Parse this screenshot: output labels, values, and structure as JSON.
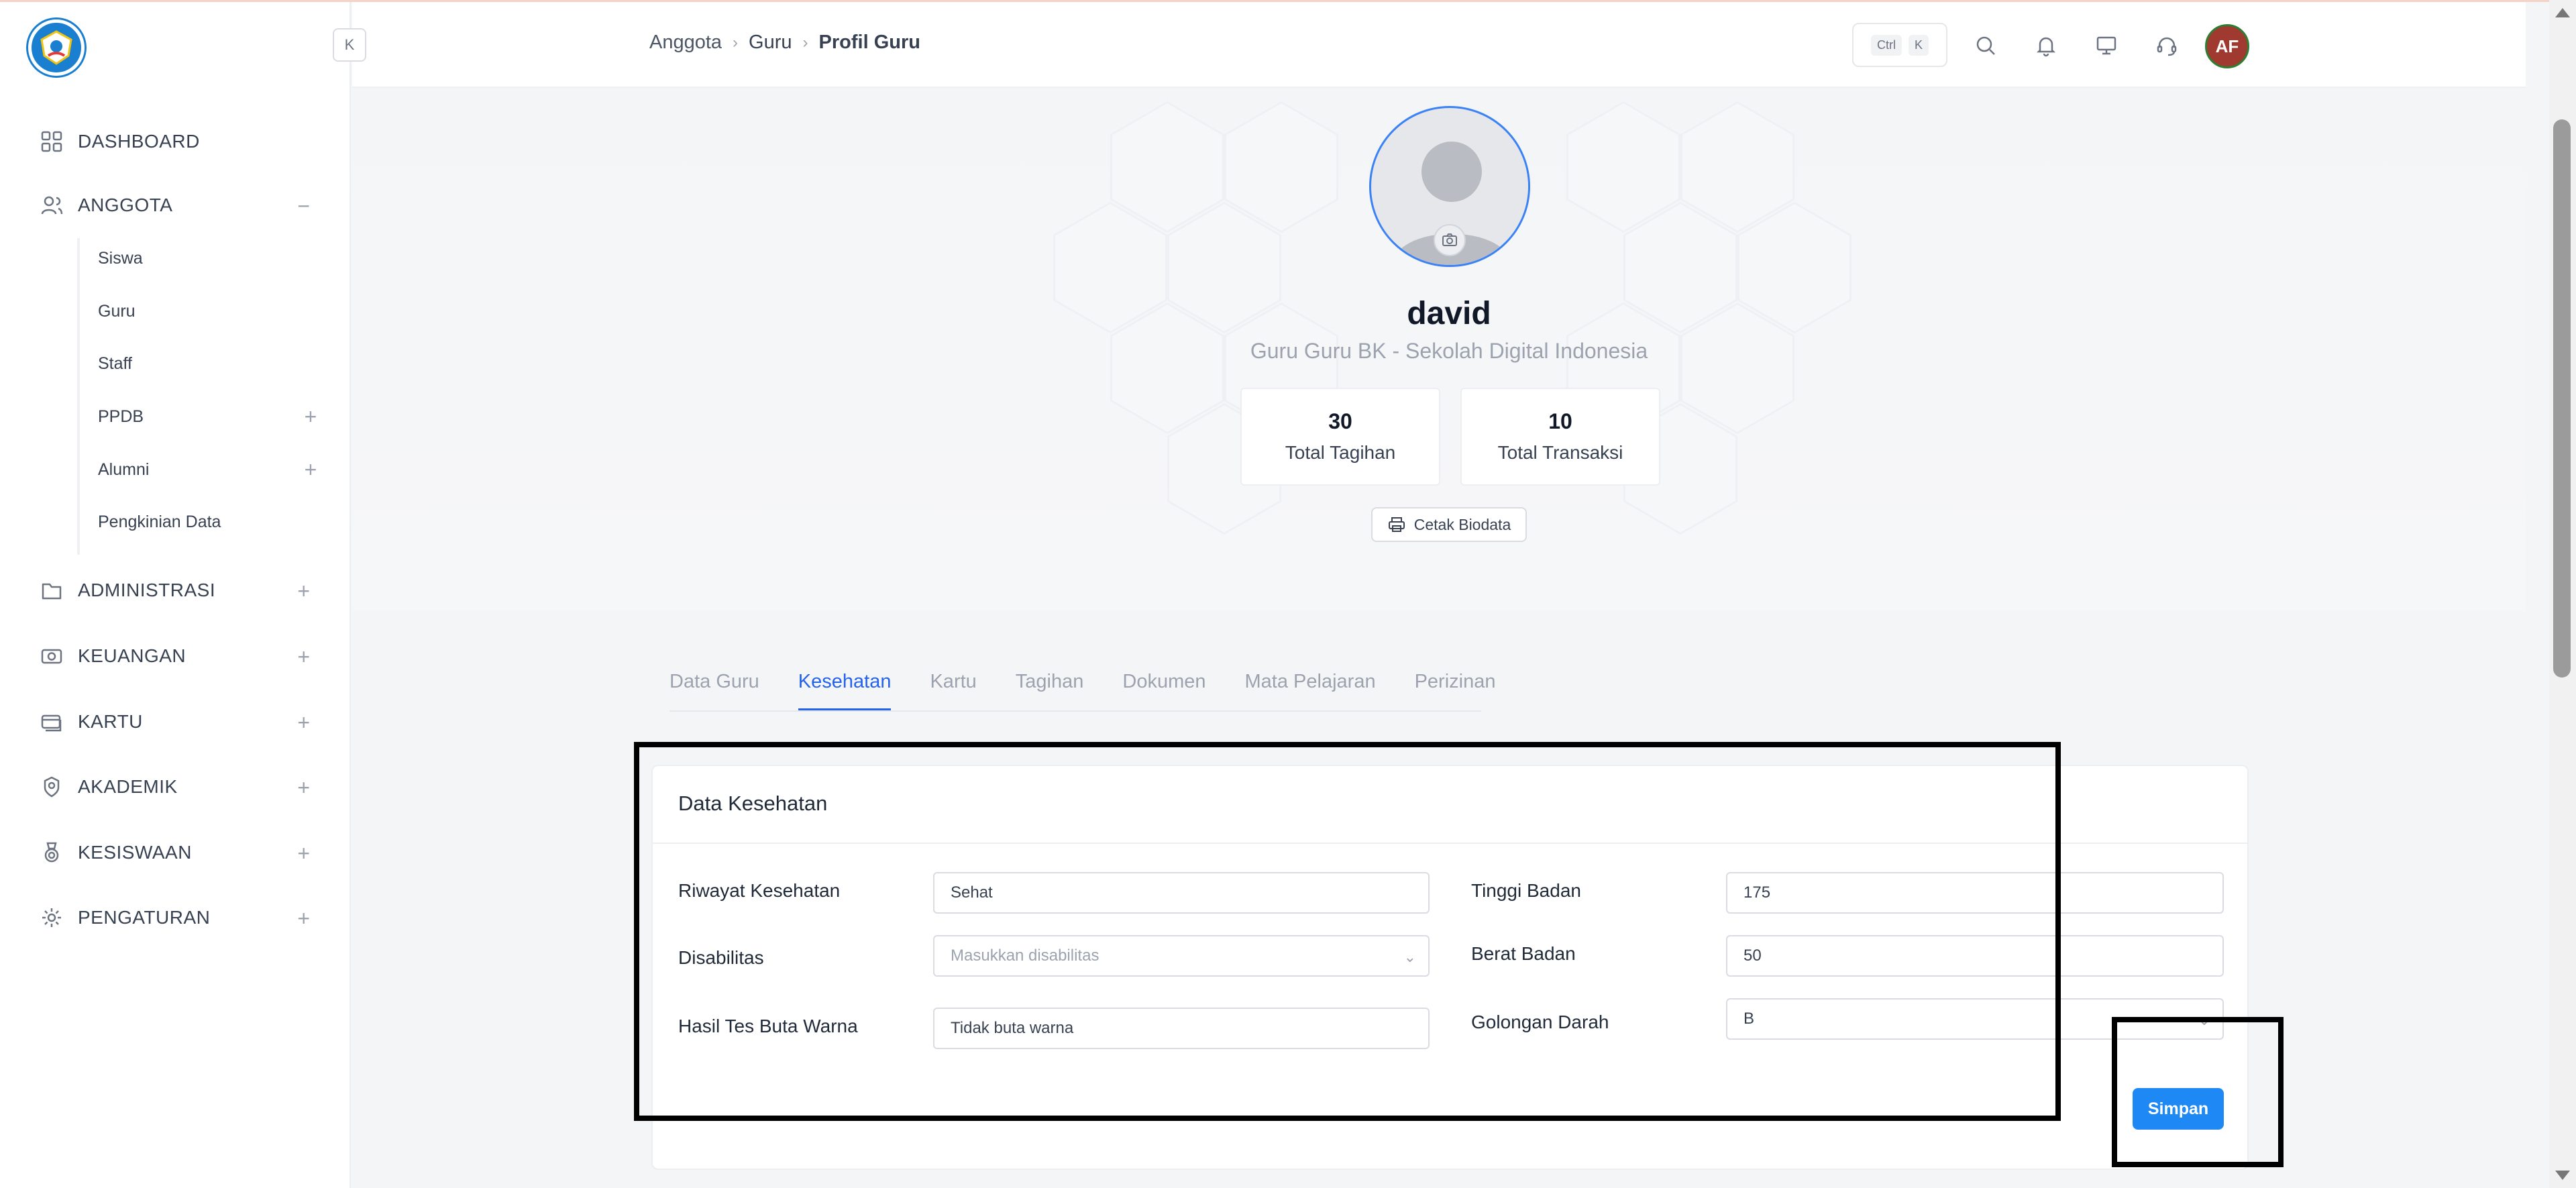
{
  "sidebar": {
    "collapse_label": "K",
    "items": [
      {
        "label": "DASHBOARD",
        "icon": "grid-icon"
      },
      {
        "label": "ANGGOTA",
        "icon": "users-icon",
        "toggle": "−"
      },
      {
        "label": "ADMINISTRASI",
        "icon": "folder-icon",
        "toggle": "+"
      },
      {
        "label": "KEUANGAN",
        "icon": "camera-money-icon",
        "toggle": "+"
      },
      {
        "label": "KARTU",
        "icon": "card-icon",
        "toggle": "+"
      },
      {
        "label": "AKADEMIK",
        "icon": "award-icon",
        "toggle": "+"
      },
      {
        "label": "KESISWAAN",
        "icon": "medal-icon",
        "toggle": "+"
      },
      {
        "label": "PENGATURAN",
        "icon": "gear-icon",
        "toggle": "+"
      }
    ],
    "subitems": [
      {
        "label": "Siswa"
      },
      {
        "label": "Guru"
      },
      {
        "label": "Staff"
      },
      {
        "label": "PPDB",
        "toggle": "+"
      },
      {
        "label": "Alumni",
        "toggle": "+"
      },
      {
        "label": "Pengkinian Data"
      }
    ]
  },
  "header": {
    "breadcrumb": [
      "Anggota",
      "Guru",
      "Profil Guru"
    ],
    "shortcut": [
      "Ctrl",
      "K"
    ],
    "avatar_initials": "AF",
    "icons": [
      "search-icon",
      "bell-icon",
      "monitor-icon",
      "headset-icon"
    ]
  },
  "profile": {
    "name": "david",
    "subtitle": "Guru Guru BK - Sekolah Digital Indonesia",
    "stats": [
      {
        "value": "30",
        "label": "Total Tagihan"
      },
      {
        "value": "10",
        "label": "Total Transaksi"
      }
    ],
    "print_label": "Cetak Biodata"
  },
  "tabs": [
    "Data Guru",
    "Kesehatan",
    "Kartu",
    "Tagihan",
    "Dokumen",
    "Mata Pelajaran",
    "Perizinan"
  ],
  "active_tab": "Kesehatan",
  "form": {
    "title": "Data Kesehatan",
    "fields": {
      "riwayat": {
        "label": "Riwayat Kesehatan",
        "value": "Sehat"
      },
      "disabilitas": {
        "label": "Disabilitas",
        "placeholder": "Masukkan disabilitas"
      },
      "buta_warna": {
        "label": "Hasil Tes Buta Warna",
        "value": "Tidak buta warna"
      },
      "tinggi": {
        "label": "Tinggi Badan",
        "value": "175"
      },
      "berat": {
        "label": "Berat Badan",
        "value": "50"
      },
      "golongan": {
        "label": "Golongan Darah",
        "value": "B"
      }
    },
    "save_label": "Simpan"
  },
  "colors": {
    "accent": "#1e88f5",
    "tab_active": "#2563eb",
    "avatar_bg": "#a0392f"
  }
}
